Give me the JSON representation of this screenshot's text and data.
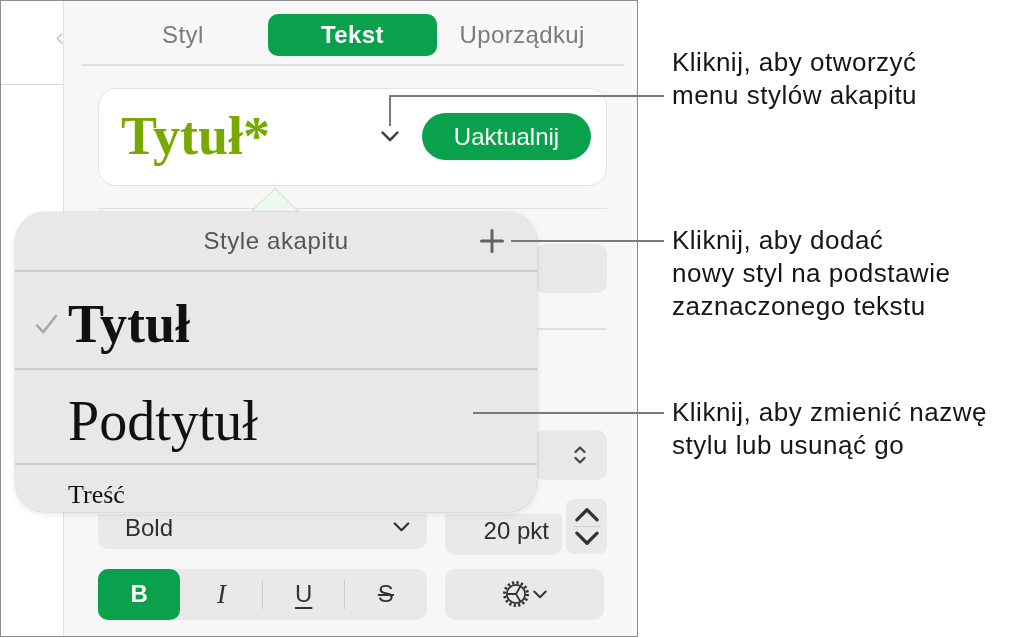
{
  "inspector": {
    "tabs": [
      {
        "label": "Styl",
        "selected": false
      },
      {
        "label": "Tekst",
        "selected": true
      },
      {
        "label": "Uporządkuj",
        "selected": false
      }
    ],
    "paragraph_style": {
      "name": "Tytuł*",
      "update_button": "Uaktualnij"
    },
    "font_style": "Bold",
    "font_size": "20 pkt",
    "format_buttons": [
      {
        "kind": "bold",
        "label": "B",
        "selected": true
      },
      {
        "kind": "italic",
        "label": "I",
        "selected": false
      },
      {
        "kind": "underline",
        "label": "U",
        "selected": false
      },
      {
        "kind": "strikethrough",
        "label": "S",
        "selected": false
      }
    ]
  },
  "style_popover": {
    "title": "Style akapitu",
    "styles": [
      {
        "kind": "title",
        "name": "Tytuł",
        "selected": true
      },
      {
        "kind": "subtitle",
        "name": "Podtytuł",
        "selected": false
      },
      {
        "kind": "body",
        "name": "Treść",
        "selected": false
      }
    ]
  },
  "callouts": [
    {
      "kind": "menu",
      "text": "Kliknij, aby otworzyć\nmenu stylów akapitu"
    },
    {
      "kind": "add",
      "text": "Kliknij, aby dodać\nnowy styl na podstawie\nzaznaczonego tekstu"
    },
    {
      "kind": "rename",
      "text": "Kliknij, aby zmienić nazwę\nstylu lub usunąć go"
    }
  ]
}
